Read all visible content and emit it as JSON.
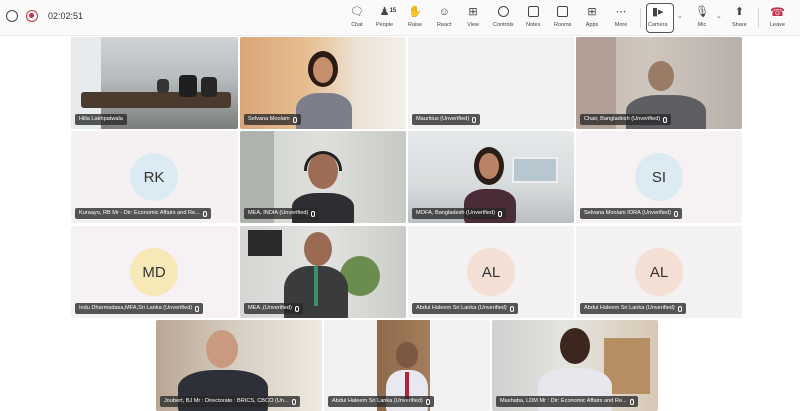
{
  "toolbar": {
    "timer": "02:02:51",
    "buttons": [
      {
        "id": "chat",
        "label": "Chat"
      },
      {
        "id": "people",
        "label": "People",
        "count": "15"
      },
      {
        "id": "raise",
        "label": "Raise"
      },
      {
        "id": "react",
        "label": "React"
      },
      {
        "id": "view",
        "label": "View"
      },
      {
        "id": "controls",
        "label": "Controls"
      },
      {
        "id": "notes",
        "label": "Notes"
      },
      {
        "id": "rooms",
        "label": "Rooms"
      },
      {
        "id": "apps",
        "label": "Apps"
      },
      {
        "id": "more",
        "label": "More"
      },
      {
        "id": "camera",
        "label": "Camera"
      },
      {
        "id": "mic",
        "label": "Mic"
      },
      {
        "id": "share",
        "label": "Share"
      },
      {
        "id": "leave",
        "label": "Leave"
      }
    ]
  },
  "participants": [
    {
      "name": "Hilla Lakhpatwala"
    },
    {
      "name": "Selvana Moolam"
    },
    {
      "name": "Mauritius (Unverified)"
    },
    {
      "name": "Chair, Bangladesh (Unverified)"
    },
    {
      "name": "Kuraayo, RB Mr - Dir: Economic Affairs and Re...",
      "initials": "RK"
    },
    {
      "name": "MEA, INDIA (Unverified)"
    },
    {
      "name": "MOFA, Bangladesh (Unverified)"
    },
    {
      "name": "Selvana Moolam IORA (Unverified)",
      "initials": "SI"
    },
    {
      "name": "Indu Dharmadasa,MFA,Sri Lanka (Unverified)",
      "initials": "MD"
    },
    {
      "name": "MEA ,(Unverified)"
    },
    {
      "name": "Abdul Haleem Sri Lanka (Unverified)",
      "initials": "AL"
    },
    {
      "name": "Abdul Haleem Sri Lanka (Unverified)",
      "initials": "AL"
    },
    {
      "name": "Joubert, BJ Mr : Directorate : BRICS, CBCO (Un..."
    },
    {
      "name": "Abdul Haleem Sri Lanka (Unverified)"
    },
    {
      "name": "Mashaba, LDM Mr : Dir: Economic Affairs and Re..."
    }
  ],
  "colors": {
    "accent_red": "#c4314b",
    "avatar_rk": "#dcebf3",
    "avatar_si": "#dcebf3",
    "avatar_md": "#f6e9b7",
    "avatar_al": "#f3dfd4"
  }
}
